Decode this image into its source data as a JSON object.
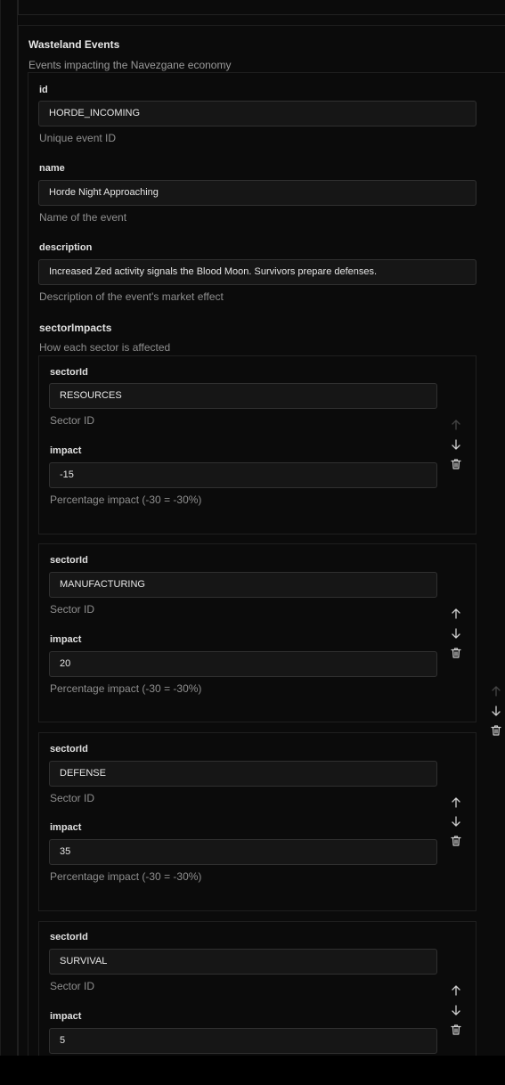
{
  "section": {
    "title": "Wasteland Events",
    "subtitle": "Events impacting the Navezgane economy"
  },
  "fields": {
    "id": {
      "label": "id",
      "value": "HORDE_INCOMING",
      "help": "Unique event ID"
    },
    "name": {
      "label": "name",
      "value": "Horde Night Approaching",
      "help": "Name of the event"
    },
    "description": {
      "label": "description",
      "value": "Increased Zed activity signals the Blood Moon. Survivors prepare defenses.",
      "help": "Description of the event's market effect"
    }
  },
  "sectorImpacts": {
    "label": "sectorImpacts",
    "help": "How each sector is affected",
    "items": [
      {
        "sectorId_label": "sectorId",
        "sectorId": "RESOURCES",
        "sectorId_help": "Sector ID",
        "impact_label": "impact",
        "impact": "-15",
        "impact_help": "Percentage impact (-30 = -30%)"
      },
      {
        "sectorId_label": "sectorId",
        "sectorId": "MANUFACTURING",
        "sectorId_help": "Sector ID",
        "impact_label": "impact",
        "impact": "20",
        "impact_help": "Percentage impact (-30 = -30%)"
      },
      {
        "sectorId_label": "sectorId",
        "sectorId": "DEFENSE",
        "sectorId_help": "Sector ID",
        "impact_label": "impact",
        "impact": "35",
        "impact_help": "Percentage impact (-30 = -30%)"
      },
      {
        "sectorId_label": "sectorId",
        "sectorId": "SURVIVAL",
        "sectorId_help": "Sector ID",
        "impact_label": "impact",
        "impact": "5",
        "impact_help": ""
      }
    ]
  },
  "icons": {
    "up": "arrow-up-icon",
    "down": "arrow-down-icon",
    "delete": "trash-icon"
  }
}
